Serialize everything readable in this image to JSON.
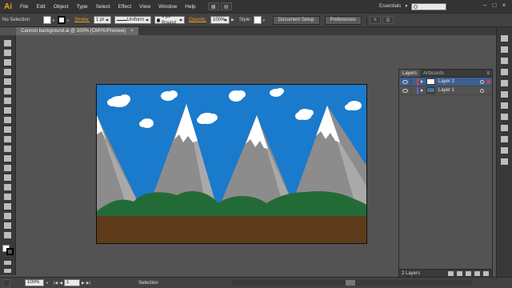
{
  "app": {
    "logo": "Ai",
    "menu": [
      "File",
      "Edit",
      "Object",
      "Type",
      "Select",
      "Effect",
      "View",
      "Window",
      "Help"
    ],
    "workspace": "Essentials",
    "window_controls": [
      "–",
      "□",
      "×"
    ]
  },
  "control_bar": {
    "selection_label": "No Selection",
    "stroke_label": "Stroke:",
    "stroke_weight": "1 pt",
    "profile": "Uniform",
    "brush": "5 pt. Round",
    "opacity_label": "Opacity:",
    "opacity_value": "100%",
    "style_label": "Style:",
    "document_setup": "Document Setup",
    "preferences": "Preferences"
  },
  "document": {
    "tab_title": "Cannon background.ai @ 100% (CMYK/Preview)",
    "close": "×"
  },
  "layers_panel": {
    "tabs": [
      "Layers",
      "Artboards"
    ],
    "menu_icon": "≡",
    "layers": [
      {
        "name": "Layer 2",
        "color": "#d94141",
        "selected": true
      },
      {
        "name": "Layer 1",
        "color": "#4f6bd8",
        "selected": false
      }
    ],
    "count": "2 Layers"
  },
  "status_bar": {
    "zoom": "100%",
    "artboard": "1",
    "tool": "Selection"
  },
  "colors": {
    "sky": "#1a7acb",
    "mountain": "#8c8c8c",
    "mountain_light": "#a9a9a9",
    "snow": "#ffffff",
    "hills": "#236b36",
    "ground": "#5e3b1a",
    "cloud": "#ffffff"
  }
}
